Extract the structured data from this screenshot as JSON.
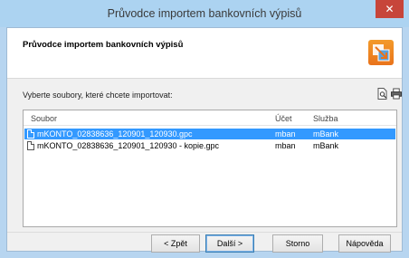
{
  "window": {
    "title": "Průvodce importem bankovních výpisů",
    "close_glyph": "✕"
  },
  "header": {
    "title": "Průvodce importem bankovních výpisů",
    "logo_icon": "import-wizard-icon"
  },
  "prompt_label": "Vyberte soubory, které chcete importovat:",
  "toolbar": {
    "icons": [
      "preview-icon",
      "print-icon"
    ]
  },
  "file_list": {
    "columns": [
      "Soubor",
      "Účet",
      "Služba"
    ],
    "rows": [
      {
        "file": "mKONTO_02838636_120901_120930.gpc",
        "account": "mban",
        "service": "mBank",
        "selected": true
      },
      {
        "file": "mKONTO_02838636_120901_120930 - kopie.gpc",
        "account": "mban",
        "service": "mBank",
        "selected": false
      }
    ]
  },
  "buttons": {
    "back": "< Zpět",
    "next": "Další >",
    "cancel": "Storno",
    "help": "Nápověda"
  },
  "colors": {
    "title_bar": "#acd3f1",
    "close_button": "#c7453a",
    "selection": "#3399ff",
    "logo": "#ef8a23"
  }
}
